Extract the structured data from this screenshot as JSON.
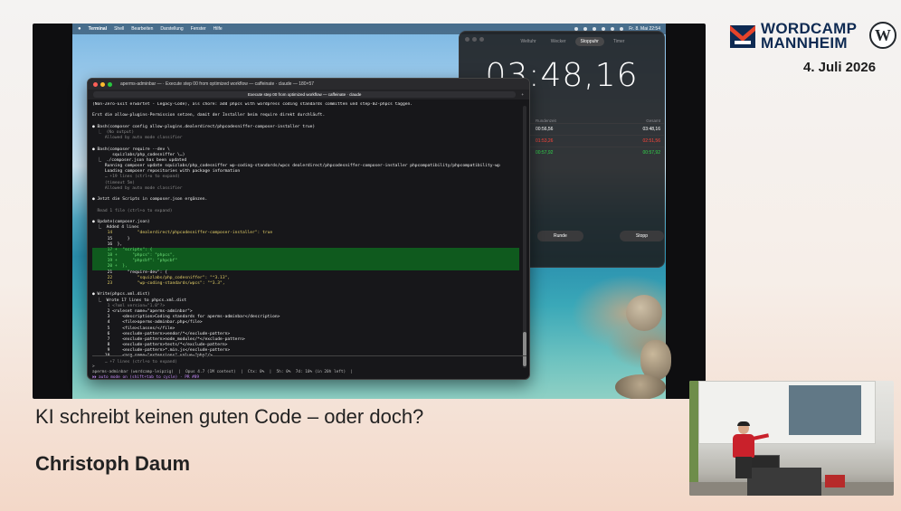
{
  "event": {
    "name_line1": "WORDCAMP",
    "name_line2": "MANNHEIM",
    "date": "4. Juli 2026",
    "brand_color": "#0e2a52",
    "accent_color": "#e5432a"
  },
  "talk": {
    "title": "KI schreibt keinen guten Code – oder doch?",
    "speaker": "Christoph Daum"
  },
  "menubar": {
    "app": "Terminal",
    "items": [
      "Shell",
      "Bearbeiten",
      "Darstellung",
      "Fenster",
      "Hilfe"
    ],
    "clock": "Fr. 8. Mai 22:54"
  },
  "clock_app": {
    "tabs": [
      "Weltuhr",
      "Wecker",
      "Stoppuhr",
      "Timer"
    ],
    "active_tab": "Stoppuhr",
    "time": "03:48,16",
    "laps_header": [
      "Rundenzeit",
      "Gesamt"
    ],
    "laps": [
      {
        "lap": "00:56,56",
        "total": "03:48,16",
        "color": "white"
      },
      {
        "lap": "01:53,26",
        "total": "02:51,56",
        "color": "red"
      },
      {
        "lap": "00:57,92",
        "total": "00:57,92",
        "color": "green"
      }
    ],
    "buttons": [
      "Runde",
      "Stopp"
    ]
  },
  "terminal": {
    "title": "aperms-adminbar — · Execute step 00 from optimized workflow — caffeinate · claude — 180×57",
    "tab": "Execute step 00 from optimized workflow — caffeinate · claude",
    "lines": [
      {
        "t": "(Non-Zero-Exit erwartet - Legacy-Code), als chore: add phpcs with wordpress coding standards committen und step-02-phpcs taggen.",
        "c": "c-white"
      },
      {
        "t": "",
        "c": ""
      },
      {
        "t": "Erst die allow-plugins-Permission setzen, damit der Installer beim require direkt durchläuft.",
        "c": "c-white"
      },
      {
        "t": "",
        "c": ""
      },
      {
        "t": "● Bash(composer config allow-plugins.dealerdirect/phpcodesniffer-composer-installer true)",
        "c": "c-white"
      },
      {
        "t": "  ⎿  (No output)",
        "c": "c-dim"
      },
      {
        "t": "     Allowed by auto mode classifier",
        "c": "c-dim"
      },
      {
        "t": "",
        "c": ""
      },
      {
        "t": "● Bash(composer require --dev \\",
        "c": "c-white"
      },
      {
        "t": "        squizlabs/php_codesniffer \\…)",
        "c": "c-white"
      },
      {
        "t": "  ⎿  ./composer.json has been updated",
        "c": "c-white"
      },
      {
        "t": "     Running composer update squizlabs/php_codesniffer wp-coding-standards/wpcs dealerdirect/phpcodesniffer-composer-installer phpcompatibility/phpcompatibility-wp",
        "c": "c-white"
      },
      {
        "t": "     Loading composer repositories with package information",
        "c": "c-white"
      },
      {
        "t": "     … +19 lines (ctrl+o to expand)",
        "c": "c-dim"
      },
      {
        "t": "     (timeout 5m)",
        "c": "c-dim"
      },
      {
        "t": "     Allowed by auto mode classifier",
        "c": "c-dim"
      },
      {
        "t": "",
        "c": ""
      },
      {
        "t": "● Jetzt die Scripts in composer.json ergänzen.",
        "c": "c-white"
      },
      {
        "t": "",
        "c": ""
      },
      {
        "t": "  Read 1 file (ctrl+o to expand)",
        "c": "c-dim"
      },
      {
        "t": "",
        "c": ""
      },
      {
        "t": "● Update(composer.json)",
        "c": "c-white"
      },
      {
        "t": "  ⎿  Added 4 lines",
        "c": "c-white"
      },
      {
        "t": "      14          \"dealerdirect/phpcodesniffer-composer-installer\": true",
        "c": "c-yellow"
      },
      {
        "t": "      15      }",
        "c": "c-white"
      },
      {
        "t": "      16  },",
        "c": "c-white"
      },
      {
        "t": "      17 +  \"scripts\": {",
        "c": "c-green",
        "hl": true
      },
      {
        "t": "      18 +      \"phpcs\": \"phpcs\",",
        "c": "c-green",
        "hl": true
      },
      {
        "t": "      19 +      \"phpcbf\": \"phpcbf\"",
        "c": "c-green",
        "hl": true
      },
      {
        "t": "      20 +  },",
        "c": "c-green",
        "hl": true
      },
      {
        "t": "      21      \"require-dev\": {",
        "c": "c-white"
      },
      {
        "t": "      22          \"squizlabs/php_codesniffer\": \"^3.13\",",
        "c": "c-yellow"
      },
      {
        "t": "      23          \"wp-coding-standards/wpcs\": \"^3.3\",",
        "c": "c-yellow"
      },
      {
        "t": "",
        "c": ""
      },
      {
        "t": "● Write(phpcs.xml.dist)",
        "c": "c-white"
      },
      {
        "t": "  ⎿  Wrote 17 lines to phpcs.xml.dist",
        "c": "c-white"
      },
      {
        "t": "      1 <?xml version=\"1.0\"?>",
        "c": "c-dim"
      },
      {
        "t": "      2 <ruleset name=\"aperms-adminbar\">",
        "c": "c-white"
      },
      {
        "t": "      3     <description>Coding standards for aperms-adminbar</description>",
        "c": "c-white"
      },
      {
        "t": "      4     <file>aperms-adminbar.php</file>",
        "c": "c-white"
      },
      {
        "t": "      5     <file>classes/</file>",
        "c": "c-white"
      },
      {
        "t": "      6     <exclude-pattern>vendor/*</exclude-pattern>",
        "c": "c-white"
      },
      {
        "t": "      7     <exclude-pattern>node_modules/*</exclude-pattern>",
        "c": "c-white"
      },
      {
        "t": "      8     <exclude-pattern>tests/*</exclude-pattern>",
        "c": "c-white"
      },
      {
        "t": "      9     <exclude-pattern>*.min.js</exclude-pattern>",
        "c": "c-white"
      },
      {
        "t": "     10     <arg name=\"extensions\" value=\"php\"/>",
        "c": "c-white"
      },
      {
        "t": "     … +7 lines (ctrl+o to expand)",
        "c": "c-dim"
      },
      {
        "t": "",
        "c": ""
      },
      {
        "t": "✳ Glitching… (30s · ↓ 1.7k tokens)",
        "c": "c-pink"
      },
      {
        "t": "  ⎿  Tip: Continue your session in Claude Code Desktop with /desktop",
        "c": "c-dim"
      }
    ],
    "prompt": "> ",
    "status_line1": "aperms-adminbar (wordcamp-leipzig)  |  Opus 4.7 (1M context)  |  Ctx: 0%  |  5h: 0%  7d: 10% (in 20h left)  |",
    "status_line2": "⏵⏵ auto mode on (shift+tab to cycle) · PR #89"
  }
}
